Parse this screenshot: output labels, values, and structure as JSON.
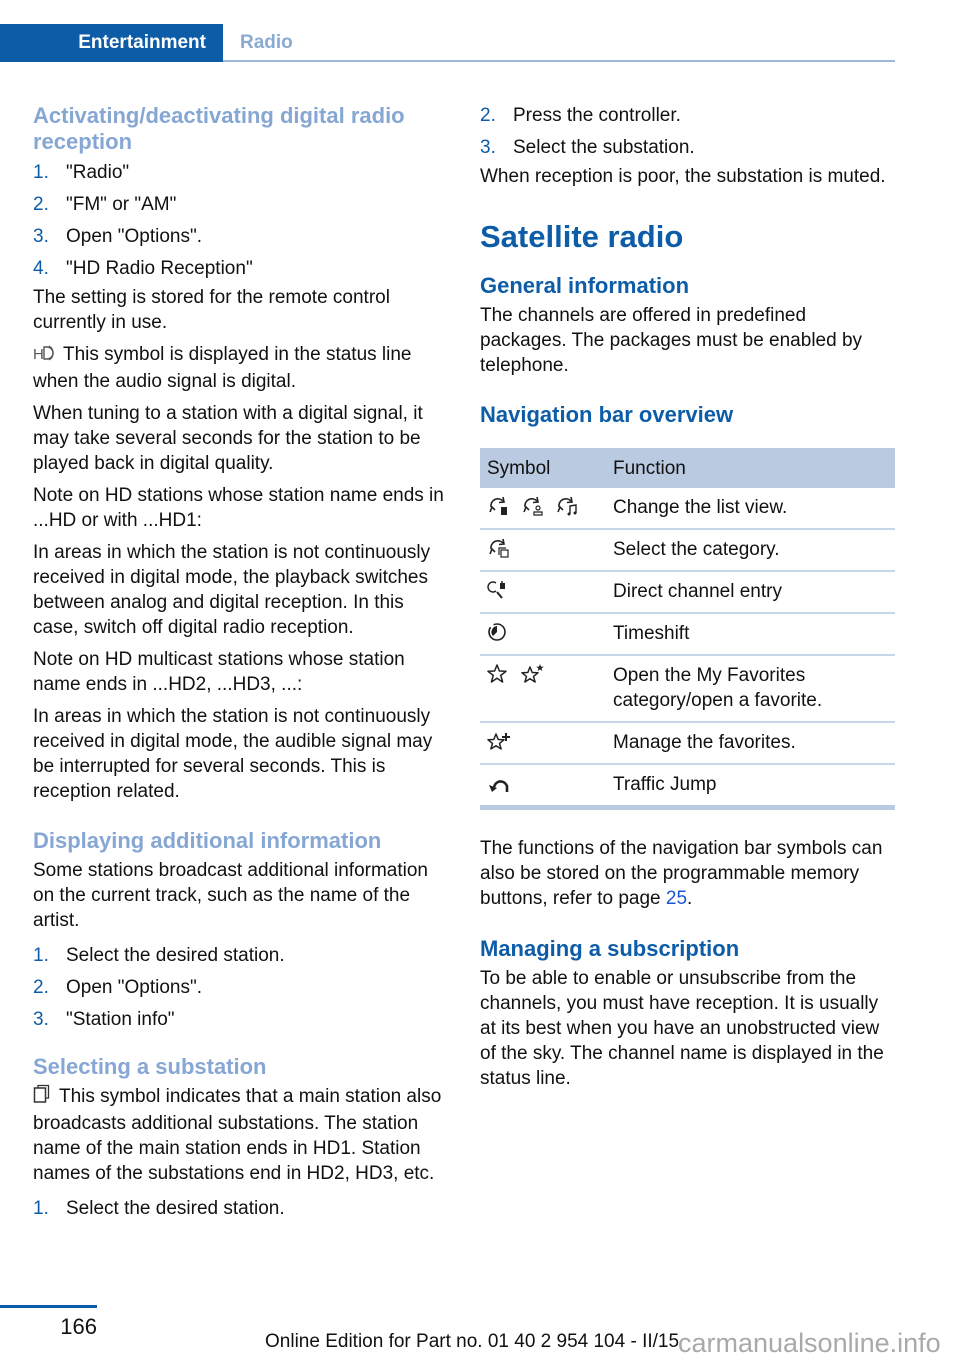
{
  "header": {
    "section": "Entertainment",
    "subsection": "Radio"
  },
  "left": {
    "s1": {
      "title": "Activating/deactivating digital radio reception",
      "steps": [
        {
          "num": "1.",
          "text": "\"Radio\""
        },
        {
          "num": "2.",
          "text": "\"FM\" or \"AM\""
        },
        {
          "num": "3.",
          "text": "Open \"Options\"."
        },
        {
          "num": "4.",
          "text": "\"HD Radio Reception\""
        }
      ],
      "p1": "The setting is stored for the remote control currently in use.",
      "p2_icon": "hd-radio-icon",
      "p2": "This symbol is displayed in the status line when the audio signal is digital.",
      "p3": "When tuning to a station with a digital signal, it may take several seconds for the station to be played back in digital quality.",
      "p4": "Note on HD stations whose station name ends in ...HD or with ...HD1:",
      "p5": "In areas in which the station is not continuously received in digital mode, the playback switches between analog and digital reception. In this case, switch off digital radio reception.",
      "p6": "Note on HD multicast stations whose station name ends in ...HD2, ...HD3, ...:",
      "p7": "In areas in which the station is not continuously received in digital mode, the audible signal may be interrupted for several seconds. This is reception related."
    },
    "s2": {
      "title": "Displaying additional information",
      "p1": "Some stations broadcast additional information on the current track, such as the name of the artist.",
      "steps": [
        {
          "num": "1.",
          "text": "Select the desired station."
        },
        {
          "num": "2.",
          "text": "Open \"Options\"."
        },
        {
          "num": "3.",
          "text": "\"Station info\""
        }
      ]
    },
    "s3": {
      "title": "Selecting a substation",
      "p1_icon": "substation-icon",
      "p1": "This symbol indicates that a main station also broadcasts additional substations. The station name of the main station ends in HD1. Station names of the substations end in HD2, HD3, etc.",
      "steps": [
        {
          "num": "1.",
          "text": "Select the desired station."
        }
      ]
    }
  },
  "right": {
    "s3_cont": {
      "steps": [
        {
          "num": "2.",
          "text": "Press the controller."
        },
        {
          "num": "3.",
          "text": "Select the substation."
        }
      ],
      "p1": "When reception is poor, the substation is muted."
    },
    "chapter_title": "Satellite radio",
    "general": {
      "title": "General information",
      "p1": "The channels are offered in predefined packages. The packages must be enabled by telephone."
    },
    "navbar": {
      "title": "Navigation bar overview",
      "columns": [
        "Symbol",
        "Function"
      ],
      "rows": [
        {
          "icons": [
            "list-view-channel-icon",
            "list-view-artist-icon",
            "list-view-music-icon"
          ],
          "function": "Change the list view."
        },
        {
          "icons": [
            "category-icon"
          ],
          "function": "Select the category."
        },
        {
          "icons": [
            "direct-channel-entry-icon"
          ],
          "function": "Direct channel entry"
        },
        {
          "icons": [
            "timeshift-icon"
          ],
          "function": "Timeshift"
        },
        {
          "icons": [
            "favorites-star-icon",
            "favorite-star-marked-icon"
          ],
          "function": "Open the My Favorites category/open a favorite."
        },
        {
          "icons": [
            "manage-favorites-icon"
          ],
          "function": "Manage the favorites."
        },
        {
          "icons": [
            "traffic-jump-icon"
          ],
          "function": "Traffic Jump"
        }
      ],
      "note_before": "The functions of the navigation bar symbols can also be stored on the programmable memory buttons, refer to page ",
      "note_link": "25",
      "note_after": "."
    },
    "subscription": {
      "title": "Managing a subscription",
      "p1": "To be able to enable or unsubscribe from the channels, you must have reception. It is usually at its best when you have an unobstructed view of the sky. The channel name is displayed in the status line."
    }
  },
  "footer": {
    "page_number": "166",
    "edition": "Online Edition for Part no. 01 40 2 954 104 - II/15",
    "watermark": "carmanualsonline.info"
  },
  "colors": {
    "brand_blue": "#0d5ca7",
    "light_heading": "#86a7d3",
    "table_header": "#b9cae1",
    "link": "#1a55d8"
  }
}
